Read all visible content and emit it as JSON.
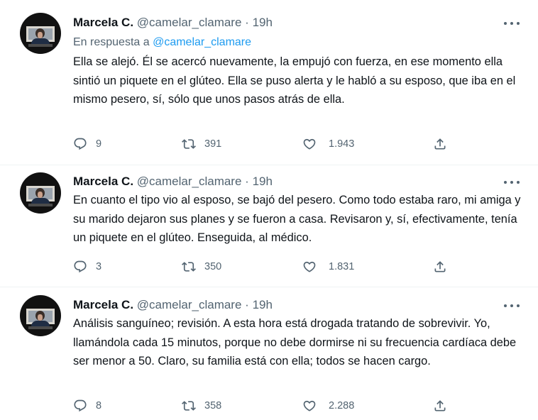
{
  "tweets": [
    {
      "author": "Marcela C.",
      "handle": "@camelar_clamare",
      "separator": "·",
      "time": "19h",
      "reply_prefix": "En respuesta a",
      "reply_to": "@camelar_clamare",
      "text": "Ella se alejó. Él se acercó nuevamente, la empujó con fuerza, en ese momento ella sintió un piquete en el glúteo. Ella se puso alerta y le habló a su esposo, que iba en el mismo pesero, sí, sólo que unos pasos atrás de ella.",
      "replies": "9",
      "retweets": "391",
      "likes": "1.943"
    },
    {
      "author": "Marcela C.",
      "handle": "@camelar_clamare",
      "separator": "·",
      "time": "19h",
      "text": "En cuanto el tipo vio al esposo, se bajó del pesero. Como todo estaba raro, mi amiga y su marido dejaron sus planes y se fueron a casa. Revisaron y, sí, efectivamente, tenía un piquete en el glúteo. Enseguida, al médico.",
      "replies": "3",
      "retweets": "350",
      "likes": "1.831"
    },
    {
      "author": "Marcela C.",
      "handle": "@camelar_clamare",
      "separator": "·",
      "time": "19h",
      "text": "Análisis sanguíneo; revisión. A esta hora está drogada tratando de sobrevivir. Yo, llamándola cada 15 minutos, porque no debe dormirse ni su frecuencia cardíaca debe ser menor a 50. Claro, su familia está con ella; todos se hacen cargo.",
      "replies": "8",
      "retweets": "358",
      "likes": "2.288"
    }
  ],
  "icons": {
    "avatar": "profile-photo",
    "more": "more-dots-icon",
    "reply": "reply-icon",
    "retweet": "retweet-icon",
    "like": "heart-icon",
    "share": "share-icon"
  },
  "colors": {
    "text": "#0f1419",
    "secondary": "#536471",
    "link": "#1d9bf0"
  }
}
